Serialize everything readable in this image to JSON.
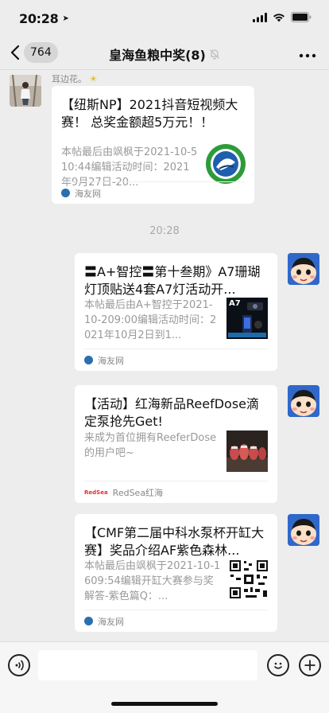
{
  "status": {
    "time": "20:28"
  },
  "nav": {
    "unread_count": "764",
    "title": "皇海鱼粮中奖(8)"
  },
  "messages": [
    {
      "sender_name": "耳边花。",
      "title": "【纽斯NP】2021抖音短视频大赛！ 总奖金额超5万元！！",
      "desc": "本帖最后由飒枫于2021-10-510:44编辑活动时间：2021年9月27日-20...",
      "source": "海友网"
    },
    {
      "timestamp": "20:28"
    },
    {
      "title": "〓A+智控〓第十叁期》A7珊瑚灯顶贴送4套A7灯活动开...",
      "desc": "本帖最后由A+智控于2021-10-209:00编辑活动时间：2021年10月2日到1...",
      "thumb_text": "A7",
      "source": "海友网"
    },
    {
      "title": "【活动】红海新品ReefDose滴定泵抢先Get!",
      "desc": "来成为首位拥有ReeferDose的用户吧~",
      "source_logo": "RedSea",
      "source": "RedSea红海"
    },
    {
      "title": "【CMF第二届中科水泵杯开缸大赛】奖品介绍AF紫色森林...",
      "desc": "本帖最后由飒枫于2021-10-1609:54编辑开缸大赛参与奖解答-紫色篇Q：...",
      "source": "海友网"
    }
  ],
  "input": {
    "value": ""
  }
}
